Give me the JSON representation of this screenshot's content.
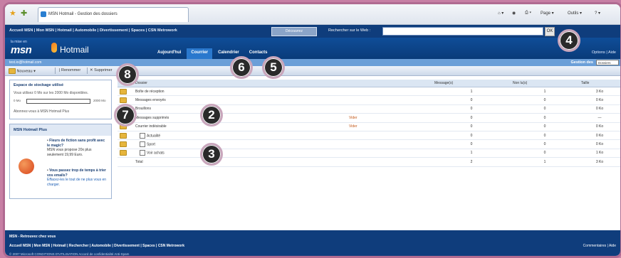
{
  "browser": {
    "tab_title": "MSN Hotmail - Gestion des dossiers",
    "cmd_items": [
      "Page ▾",
      "Outils ▾"
    ]
  },
  "msn_nav": {
    "links": "Accueil MSN | Mon MSN | Hotmail | Automobile | Divertissement | Spaces | CSN Metrowork",
    "chip_label": "Découvrez",
    "search_label": "Rechercher sur le Web :",
    "search_value": "",
    "search_go": "OK"
  },
  "header": {
    "logo_small": "la mise en",
    "logo": "msn",
    "product": "Hotmail",
    "tabs": [
      "Aujourd'hui",
      "Courrier",
      "Calendrier",
      "Contacts"
    ],
    "active_tab": "Courrier",
    "options_label": "Options | Aide"
  },
  "account": {
    "email": "test.io@hotmail.com",
    "gestion_label": "Gestion des",
    "select_value": "Dossiers"
  },
  "action_toolbar": {
    "new_label": "Nouveau",
    "rename_label": "Renommer",
    "delete_label": "Supprimer"
  },
  "storage": {
    "title": "Espace de stockage utilisé",
    "text": "Vous utilisez 0 Mo sur les 2000 Mo disponibles.",
    "used_fraction": 0.0,
    "min_label": "0 Mo",
    "max_label": "2000 Mo",
    "upgrade_text": "Abonnez-vous à MSN Hotmail Plus"
  },
  "plus_panel": {
    "title": "MSN Hotmail Plus",
    "item1_title": "Fleurs de fiction sans profit avec le magic?",
    "item1_text": "MSN vous propose 20x plus seulement 19,99 Euro.",
    "item2_title": "Vous passez trop de temps à trier vos emails?",
    "item2_text": "Effacez-les le tout de ne plus vous en charger."
  },
  "grid": {
    "headers": [
      "",
      "Dossier",
      "",
      "Message(s)",
      "Non lu(s)",
      "Taille"
    ],
    "rows": [
      {
        "name": "Boîte de réception",
        "checkbox": false,
        "wipe": "",
        "messages": "1",
        "unread": "1",
        "size": "3 Ko"
      },
      {
        "name": "Messages envoyés",
        "checkbox": false,
        "wipe": "",
        "messages": "0",
        "unread": "0",
        "size": "0 Ko"
      },
      {
        "name": "Brouillons",
        "checkbox": false,
        "wipe": "",
        "messages": "0",
        "unread": "0",
        "size": "0 Ko"
      },
      {
        "name": "Messages supprimés",
        "checkbox": false,
        "wipe": "Vider",
        "messages": "0",
        "unread": "0",
        "size": "—"
      },
      {
        "name": "Courrier indésirable",
        "checkbox": false,
        "wipe": "Vider",
        "messages": "0",
        "unread": "0",
        "size": "0 Ko"
      },
      {
        "name": "Actualité",
        "checkbox": true,
        "wipe": "",
        "messages": "0",
        "unread": "0",
        "size": "0 Ko"
      },
      {
        "name": "Sport",
        "checkbox": true,
        "wipe": "",
        "messages": "0",
        "unread": "0",
        "size": "0 Ko"
      },
      {
        "name": "Voir achats",
        "checkbox": true,
        "wipe": "",
        "messages": "1",
        "unread": "0",
        "size": "1 Ko"
      },
      {
        "name": "Total",
        "checkbox": false,
        "wipe": "",
        "messages": "2",
        "unread": "1",
        "size": "3 Ko"
      }
    ]
  },
  "footer": {
    "line1": "MSN - Retrouvez chez vous",
    "line2": "Accueil MSN | Mon MSN | Hotmail | Rechercher | Automobile | Divertissement | Spaces | CSN Metrowork",
    "line3": "© 2007 Microsoft  CONDITIONS D'UTILISATION  Accord de confidentialité  Anti-Spam",
    "right": "Commentaires | Aide"
  },
  "callouts": [
    "8",
    "7",
    "2",
    "3",
    "6",
    "5",
    "4"
  ],
  "colors": {
    "accent": "#0f3d7c",
    "frame": "#b06a91",
    "callout_bg": "#2a2a2a"
  }
}
